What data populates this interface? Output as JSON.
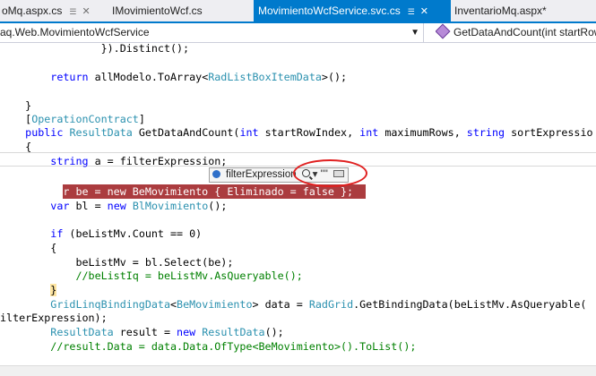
{
  "tabs": [
    {
      "label": "oMq.aspx.cs",
      "pin": "☰",
      "close": "✕",
      "active": false
    },
    {
      "label": "IMovimientoWcf.cs",
      "active": false
    },
    {
      "label": "MovimientoWcfService.svc.cs",
      "pin": "☰",
      "close": "✕",
      "active": true
    },
    {
      "label": "InventarioMq.aspx*",
      "active": false
    }
  ],
  "nav": {
    "left": "aq.Web.MovimientoWcfService",
    "right": "GetDataAndCount(int startRowIn"
  },
  "code": {
    "l0": {
      "a": "                }).Distinct();"
    },
    "l1": {
      "a": "        ",
      "b": "return",
      "c": " allModelo.ToArray<",
      "d": "RadListBoxItemData",
      "e": ">();"
    },
    "l2": {
      "a": ""
    },
    "l3": {
      "a": "    }"
    },
    "l4": {
      "a": "    [",
      "b": "OperationContract",
      "c": "]"
    },
    "l5": {
      "a": "    ",
      "b": "public",
      "c": " ",
      "d": "ResultData",
      "e": " GetDataAndCount(",
      "f": "int",
      "g": " startRowIndex, ",
      "h": "int",
      "i": " maximumRows, ",
      "j": "string",
      "k": " sortExpressio"
    },
    "l6": {
      "a": "    {"
    },
    "l7": {
      "a": "        ",
      "b": "string",
      "c": " a = filterExpression;"
    },
    "l8": {
      "a": ""
    },
    "l9": {
      "a": "        ",
      "b": "var be = new BeMovimiento { Eliminado = false };"
    },
    "l10": {
      "a": "        ",
      "b": "var",
      "c": " bl = ",
      "d": "new",
      "e": " ",
      "f": "BlMovimiento",
      "g": "();"
    },
    "l11": {
      "a": ""
    },
    "l12": {
      "a": "        ",
      "b": "if",
      "c": " (beListMv.Count == 0)"
    },
    "l13": {
      "a": "        {"
    },
    "l14": {
      "a": "            beListMv = bl.Select(be);"
    },
    "l15": {
      "a": "            ",
      "b": "//beListIq = beListMv.AsQueryable();"
    },
    "l16": {
      "a": "        ",
      "b": "}"
    },
    "l17": {
      "a": "        ",
      "b": "GridLinqBindingData",
      "c": "<",
      "d": "BeMovimiento",
      "e": "> data = ",
      "f": "RadGrid",
      "g": ".GetBindingData(beListMv.AsQueryable("
    },
    "l18": {
      "a": "ilterExpression);"
    },
    "l19": {
      "a": "        ",
      "b": "ResultData",
      "c": " result = ",
      "d": "new",
      "e": " ",
      "f": "ResultData",
      "g": "();"
    },
    "l20": {
      "a": "        ",
      "b": "//result.Data = data.Data.OfType<BeMovimiento>().ToList();"
    }
  },
  "datatip": {
    "name": "filterExpression",
    "dropdown": "▾",
    "value": "\"\"",
    "icons": [
      "variable-icon",
      "magnifier-icon",
      "pin-icon"
    ]
  },
  "colors": {
    "accent": "#007acc",
    "keyword": "#0000ff",
    "type": "#2b91af",
    "comment": "#008000",
    "breakpoint": "#ab3c3f",
    "annotation": "#e02020"
  }
}
